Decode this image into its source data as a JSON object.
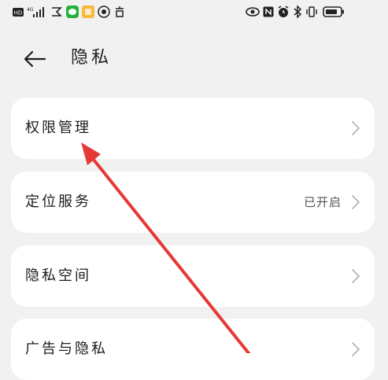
{
  "status_bar": {
    "left_icons": [
      "hd-icon",
      "signal-4g-icon",
      "app-notification-icon",
      "wechat-icon",
      "app-icon",
      "app-icon",
      "app-icon"
    ],
    "signal_label": "4G",
    "right_icons": [
      "eye-icon",
      "nfc-icon",
      "alarm-icon",
      "bluetooth-icon",
      "vibrate-icon",
      "battery-icon"
    ]
  },
  "header": {
    "title": "隐私"
  },
  "items": [
    {
      "label": "权限管理",
      "value": ""
    },
    {
      "label": "定位服务",
      "value": "已开启"
    },
    {
      "label": "隐私空间",
      "value": ""
    },
    {
      "label": "广告与隐私",
      "value": ""
    }
  ],
  "colors": {
    "background": "#f1f1f1",
    "card": "#ffffff",
    "annotation_arrow": "#e53935"
  }
}
